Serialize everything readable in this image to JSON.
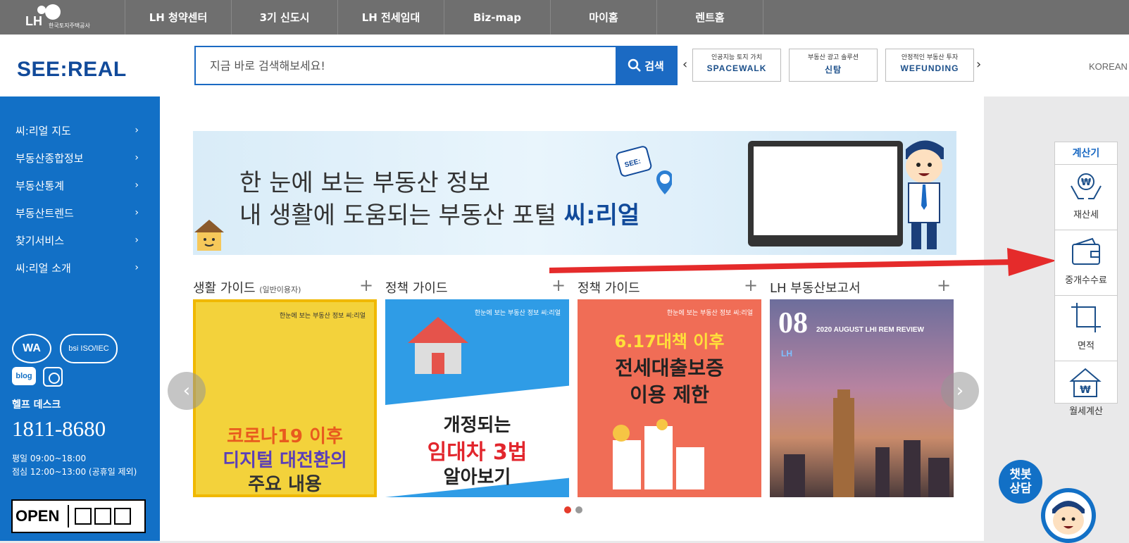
{
  "topnav": {
    "logo_text": "LH",
    "logo_sub": "한국토지주택공사",
    "items": [
      "LH 청약센터",
      "3기 신도시",
      "LH 전세임대",
      "Biz-map",
      "마이홈",
      "렌트홈"
    ]
  },
  "header": {
    "brand": "SEE:REAL",
    "search_placeholder": "지금 바로 검색해보세요!",
    "search_button": "검색",
    "banners": [
      {
        "caption": "인공지능 토지 가치",
        "name": "SPACEWALK"
      },
      {
        "caption": "부동산 광고 솔루션",
        "name": "신탐"
      },
      {
        "caption": "안정적인 부동산 투자",
        "name": "WEFUNDING"
      }
    ],
    "language": "KOREAN"
  },
  "sidebar": {
    "menu": [
      "씨:리얼 지도",
      "부동산종합정보",
      "부동산통계",
      "부동산트렌드",
      "찾기서비스",
      "씨:리얼 소개"
    ],
    "cert1": "WA",
    "cert2": "bsi ISO/IEC",
    "blog": "blog",
    "help_title": "헬프 데스크",
    "help_phone": "1811-8680",
    "hours_weekday": "평일 09:00~18:00",
    "hours_lunch": "점심 12:00~13:00 (공휴일 제외)",
    "open_label": "OPEN"
  },
  "hero": {
    "line1": "한 눈에 보는 부동산 정보",
    "line2_prefix": "내 생활에 도움되는 부동산 포털 ",
    "line2_brand": "씨:리얼"
  },
  "sections": [
    {
      "title": "생활 가이드",
      "sub": "(일반이용자)"
    },
    {
      "title": "정책 가이드",
      "sub": ""
    },
    {
      "title": "정책 가이드",
      "sub": ""
    },
    {
      "title": "LH 부동산보고서",
      "sub": ""
    }
  ],
  "cards": [
    {
      "head": "한눈에 보는 부동산 정보 씨:리얼",
      "text1": "코로나19 이후",
      "text2": "디지털 대전환의",
      "text3": "주요 내용"
    },
    {
      "head": "한눈에 보는 부동산 정보 씨:리얼",
      "text1": "개정되는",
      "text2": "임대차 3법",
      "text3": "알아보기"
    },
    {
      "head": "한눈에 보는 부동산 정보 씨:리얼",
      "text1": "6.17대책 이후",
      "text2": "전세대출보증",
      "text3": "이용 제한"
    },
    {
      "head": "",
      "text1": "08",
      "text2": "2020 AUGUST LHI REM REVIEW",
      "text3": "LH"
    }
  ],
  "calculator": {
    "title": "계산기",
    "items": [
      "재산세",
      "중개수수료",
      "면적",
      "월세계산"
    ]
  },
  "chatbot": {
    "label1": "챗봇",
    "label2": "상담"
  },
  "colors": {
    "brand_blue": "#1270c6",
    "accent_red": "#e53b2b",
    "topbar_gray": "#6f6f6f"
  }
}
